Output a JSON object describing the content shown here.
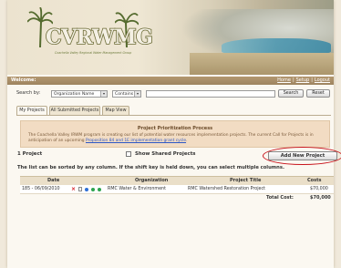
{
  "header": {
    "logo_text": "CVRWMG",
    "logo_subtitle": "Coachella Valley Regional Water Management Group"
  },
  "welcome_bar": {
    "welcome": "Welcome:",
    "links": [
      "Home",
      "Setup",
      "Logout"
    ]
  },
  "search": {
    "label": "Search by:",
    "field_select": "Organization Name",
    "operator_select": "Contains",
    "query_value": "",
    "search_button": "Search",
    "reset_button": "Reset"
  },
  "tabs": [
    "My Projects",
    "All Submitted Projects",
    "Map View"
  ],
  "info": {
    "title": "Project Prioritization Process",
    "text_before_link": "The Coachella Valley IRWM program is creating our list of potential water resources implementation projects. The current Call for Projects is in anticipation of an upcoming ",
    "link_text": "Proposition 84 and 1E implementation grant cycle",
    "text_after_link": "."
  },
  "toolbar": {
    "project_count": "1 Project",
    "show_shared_label": "Show Shared Projects",
    "add_button": "Add New Project"
  },
  "sort_note": "The list can be sorted by any column. If the shift key is held down, you can select multiple columns.",
  "table": {
    "columns": [
      "Date",
      "Organization",
      "Project Title",
      "Costs"
    ],
    "rows": [
      {
        "date": "185 - 06/09/2010",
        "organization": "RMC Water & Environment",
        "title": "RMC Watershed Restoration Project",
        "cost": "$70,000"
      }
    ],
    "total_label": "Total Cost:",
    "total_value": "$70,000"
  },
  "colors": {
    "welcome_bar": "#a88d66",
    "accent_red": "#c8141c",
    "info_bg": "#f2dcc3"
  }
}
